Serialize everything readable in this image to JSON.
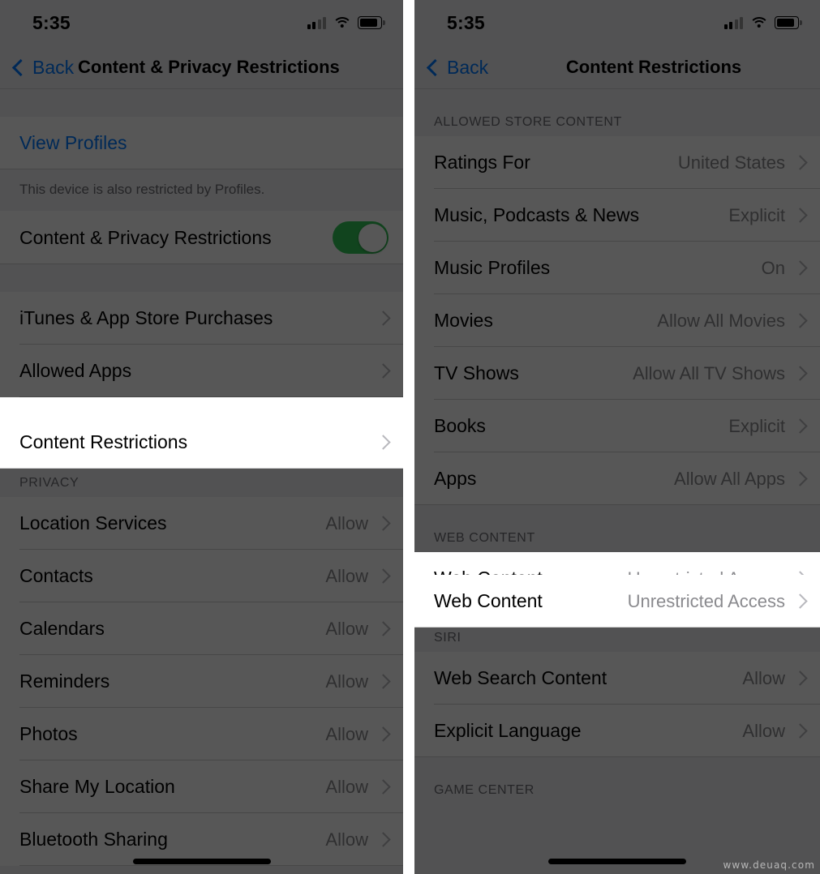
{
  "left_panel": {
    "status_bar": {
      "time": "5:35",
      "signal_icon": "cellular-bars-icon",
      "wifi_icon": "wifi-icon",
      "battery_icon": "battery-icon"
    },
    "nav": {
      "back_label": "Back",
      "title": "Content & Privacy Restrictions"
    },
    "profiles": {
      "link_label": "View Profiles",
      "note": "This device is also restricted by Profiles."
    },
    "master_toggle": {
      "label": "Content & Privacy Restrictions",
      "state": "on",
      "color": "#34c759"
    },
    "restrictions": [
      {
        "label": "iTunes & App Store Purchases",
        "value": ""
      },
      {
        "label": "Allowed Apps",
        "value": ""
      },
      {
        "label": "Content Restrictions",
        "value": "",
        "highlighted": true
      }
    ],
    "privacy_header": "PRIVACY",
    "privacy": [
      {
        "label": "Location Services",
        "value": "Allow"
      },
      {
        "label": "Contacts",
        "value": "Allow"
      },
      {
        "label": "Calendars",
        "value": "Allow"
      },
      {
        "label": "Reminders",
        "value": "Allow"
      },
      {
        "label": "Photos",
        "value": "Allow"
      },
      {
        "label": "Share My Location",
        "value": "Allow"
      },
      {
        "label": "Bluetooth Sharing",
        "value": "Allow"
      }
    ]
  },
  "right_panel": {
    "status_bar": {
      "time": "5:35",
      "signal_icon": "cellular-bars-icon",
      "wifi_icon": "wifi-icon",
      "battery_icon": "battery-icon"
    },
    "nav": {
      "back_label": "Back",
      "title": "Content Restrictions"
    },
    "store_header": "ALLOWED STORE CONTENT",
    "store": [
      {
        "label": "Ratings For",
        "value": "United States"
      },
      {
        "label": "Music, Podcasts & News",
        "value": "Explicit"
      },
      {
        "label": "Music Profiles",
        "value": "On"
      },
      {
        "label": "Movies",
        "value": "Allow All Movies"
      },
      {
        "label": "TV Shows",
        "value": "Allow All TV Shows"
      },
      {
        "label": "Books",
        "value": "Explicit"
      },
      {
        "label": "Apps",
        "value": "Allow All Apps"
      }
    ],
    "web_header": "WEB CONTENT",
    "web": [
      {
        "label": "Web Content",
        "value": "Unrestricted Access",
        "highlighted": true
      }
    ],
    "siri_header": "SIRI",
    "siri": [
      {
        "label": "Web Search Content",
        "value": "Allow"
      },
      {
        "label": "Explicit Language",
        "value": "Allow"
      }
    ],
    "game_center_header": "GAME CENTER"
  },
  "watermark": "www.deuaq.com"
}
